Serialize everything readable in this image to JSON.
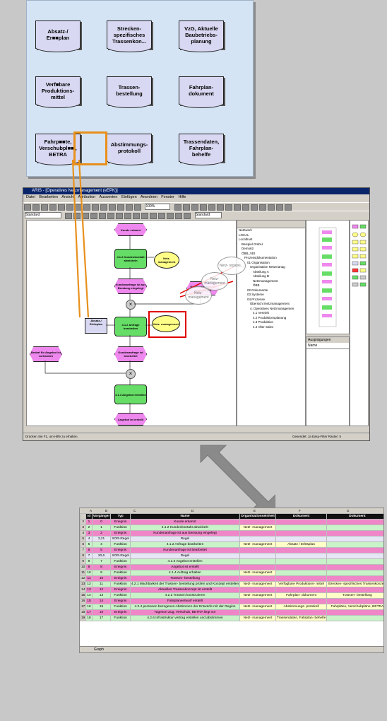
{
  "documents": [
    {
      "label": "Absatz-/ Er■■plan"
    },
    {
      "label": "Strecken- spezifisches Trassenkon..."
    },
    {
      "label": "VzG, Aktuelle Baubetriebs- planung"
    },
    {
      "label": "Verf■bare Produktions- mittel"
    },
    {
      "label": "Trassen- bestellung"
    },
    {
      "label": "Fahrplan- dokument"
    },
    {
      "label": "Fahrp■■te, Verschubpl■■ , BETRA"
    },
    {
      "label": "Abstimmungs- protokoll"
    },
    {
      "label": "Trassendaten, Fahrplan- behelfe"
    }
  ],
  "aris": {
    "title": "ARIS - [Operatives Netzmanagement (eEPK)]",
    "menu": "Datei Bearbeiten Ansicht Attribution Auswerten Einfügen Anordnen Fenster Hilfe",
    "zoom": "100%",
    "style_left": "Standard",
    "style_right": "Standard",
    "status_left": "Drücken Sie F1, um Hilfe zu erhalten.",
    "status_right": "Gesendet: Ja    Easy-Filter    Raster: 5",
    "canvas": {
      "events": [
        "Kunde erkannt",
        "Kundenanfrage ist aus Beratung eingelegt",
        "Kundenanfrage ist bearbeitet",
        "Kundenanfrage ist eingegangen",
        "Bedarf für Angebot ist vorhanden",
        "Angebot ist erstellt"
      ],
      "functions": [
        "4.1.2 Kundenkontakt abwickeln",
        "4.1.2 Anfrage bearbeiten",
        "4.1.3 Angebot erstellen"
      ],
      "org": "Netz- management",
      "org_highlight": "Netz- management",
      "doc": "Absatz-/ Erlösplan",
      "callouts": [
        "Netz- organis...",
        "Netz- management",
        "Netz- management"
      ]
    },
    "explorer": [
      "Netzwerk",
      "LOCAL",
      "Localhost",
      "Beispiel GmbH",
      "Demo62",
      "ÖBB_VEt",
      "Prozessdokumentation",
      "01 Organisation",
      "Organisation Netzmanag",
      "Abteilung A",
      "Abteilung B",
      "Netzmanagement",
      "ÖBB",
      "02 Dokumente",
      "03 Systeme",
      "04 Prozesse",
      "Übersicht Netzmanagement",
      "4. Operatives Netzmanagemen",
      "4.1 Vertrieb",
      "4.2 Produktionsplanung",
      "4.3 Produktion",
      "4.4 After Sales"
    ],
    "attrib_title": "Ausprägungen",
    "attrib_col": "Name"
  },
  "excel": {
    "col_letters": [
      "A",
      "B",
      "C",
      "D",
      "E",
      "F",
      "G"
    ],
    "headers": [
      "Id",
      "Vorgänger",
      "Typ",
      "Name",
      "Organisationseinheit",
      "Dokument",
      "Dokument"
    ],
    "rows": [
      {
        "rn": "2",
        "id": "1",
        "v": "0",
        "typ": "Ereignis",
        "name": "Kunde erkannt",
        "org": "",
        "d1": "",
        "d2": "",
        "k": "ev"
      },
      {
        "rn": "3",
        "id": "2",
        "v": "1",
        "typ": "Funktion",
        "name": "4.1.2 Kundenkontakt abwickeln",
        "org": "Netz- management",
        "d1": "",
        "d2": "",
        "k": "fn"
      },
      {
        "rn": "4",
        "id": "3",
        "v": "2",
        "typ": "Ereignis",
        "name": "Kundenanfrage ist aus Beratung eingelegt",
        "org": "",
        "d1": "",
        "d2": "",
        "k": "ev"
      },
      {
        "rn": "5",
        "id": "4",
        "v": "3,21",
        "typ": "XOR-Regel",
        "name": "Regel",
        "org": "",
        "d1": "",
        "d2": "",
        "k": "op"
      },
      {
        "rn": "6",
        "id": "5",
        "v": "4",
        "typ": "Funktion",
        "name": "4.1.2 Anfrage bearbeiten",
        "org": "Netz- management",
        "d1": "Absatz / Erlösplan",
        "d2": "",
        "k": "fn"
      },
      {
        "rn": "7",
        "id": "6",
        "v": "5",
        "typ": "Ereignis",
        "name": "Kundenanfrage ist bearbeitet",
        "org": "",
        "d1": "",
        "d2": "",
        "k": "ev"
      },
      {
        "rn": "8",
        "id": "7",
        "v": "20,6",
        "typ": "XOR-Regel",
        "name": "Regel",
        "org": "",
        "d1": "",
        "d2": "",
        "k": "op"
      },
      {
        "rn": "9",
        "id": "8",
        "v": "7",
        "typ": "Funktion",
        "name": "4.1.3 Angebot erstellen",
        "org": "",
        "d1": "",
        "d2": "",
        "k": "fn"
      },
      {
        "rn": "10",
        "id": "9",
        "v": "8",
        "typ": "Ereignis",
        "name": "Angebot ist erstellt",
        "org": "",
        "d1": "",
        "d2": "",
        "k": "ev"
      },
      {
        "rn": "11",
        "id": "10",
        "v": "9",
        "typ": "Funktion",
        "name": "4.1.4 Auftrag erhalten",
        "org": "Netz- management",
        "d1": "",
        "d2": "",
        "k": "fn"
      },
      {
        "rn": "12",
        "id": "11",
        "v": "10",
        "typ": "Ereignis",
        "name": "Trassen- bestellung",
        "org": "",
        "d1": "",
        "d2": "",
        "k": "ev"
      },
      {
        "rn": "13",
        "id": "12",
        "v": "11",
        "typ": "Funktion",
        "name": "4.2.1 Machbarkeit der Trassen- bestellung prüfen und Konzept erstellen",
        "org": "Netz- management",
        "d1": "Verfügbare Produktions- mittel",
        "d2": "Strecken- spezifisches Trassenkonzept",
        "k": "fn"
      },
      {
        "rn": "14",
        "id": "13",
        "v": "12",
        "typ": "Ereignis",
        "name": "Aktuelles Trassenkonzept ist erstellt",
        "org": "",
        "d1": "",
        "d2": "",
        "k": "ev"
      },
      {
        "rn": "15",
        "id": "14",
        "v": "13",
        "typ": "Funktion",
        "name": "4.2.2 Trassen konstruieren",
        "org": "Netz- management",
        "d1": "Fahrplan- dokument",
        "d2": "Trassen- bestellung",
        "k": "fn"
      },
      {
        "rn": "16",
        "id": "15",
        "v": "14",
        "typ": "Ereignis",
        "name": "Fahrplanentwurf erstellt",
        "org": "",
        "d1": "",
        "d2": "",
        "k": "ev"
      },
      {
        "rn": "17",
        "id": "16",
        "v": "15",
        "typ": "Funktion",
        "name": "4.2.4 personen bezogenes Abstimmen der Entwürfe mit der Region",
        "org": "Netz- management",
        "d1": "Abstimmungs- protokoll",
        "d2": "Fahrpläne, Verschubpläne, BETRA",
        "k": "fn"
      },
      {
        "rn": "18",
        "id": "17",
        "v": "16",
        "typ": "Ereignis",
        "name": "Tagesort Zug, Verschub, BETRA liegt vor",
        "org": "",
        "d1": "",
        "d2": "",
        "k": "ev"
      },
      {
        "rn": "19",
        "id": "18",
        "v": "17",
        "typ": "Funktion",
        "name": "4.2.6 Infrastruktur vertrag erstellen und abstimmen",
        "org": "Netz- management",
        "d1": "Trassendaten, Fahrplan- behelfe",
        "d2": "",
        "k": "fn"
      }
    ],
    "sheet_tab": "Graph"
  },
  "colors": {
    "background": "#c8c8c8",
    "doc_panel": "#d4e4f4",
    "highlight": "#e8901c",
    "highlight_red": "#e00000",
    "event": "#ee88ee",
    "function": "#66dd66",
    "org": "#ffff88",
    "arrow": "#8a8a8a"
  }
}
